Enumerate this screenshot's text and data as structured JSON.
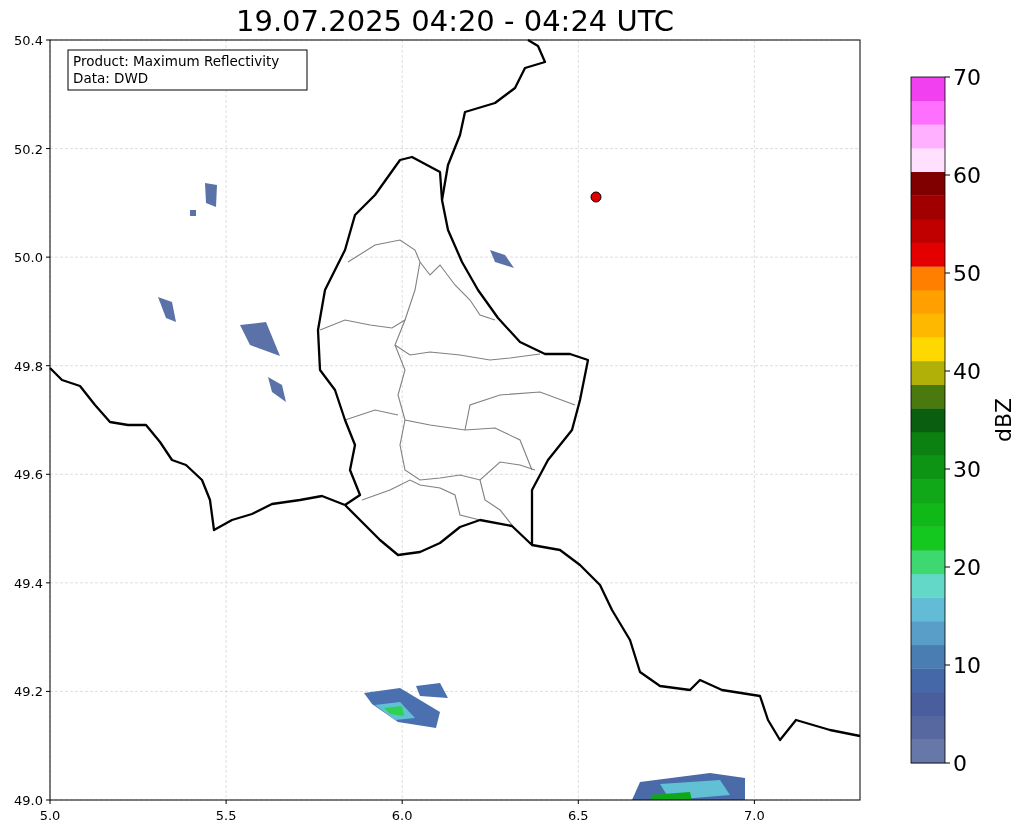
{
  "title": "19.07.2025 04:20 - 04:24 UTC",
  "info_box": {
    "lines": [
      "Product: Maximum Reflectivity",
      "Data: DWD"
    ]
  },
  "x_axis": {
    "ticks": [
      "5.0",
      "5.5",
      "6.0",
      "6.5",
      "7.0"
    ]
  },
  "y_axis": {
    "ticks": [
      "50.4",
      "50.2",
      "50.0",
      "49.8",
      "49.6",
      "49.4",
      "49.2",
      "49.0"
    ]
  },
  "colorbar": {
    "label": "dBZ",
    "ticks": [
      "70",
      "60",
      "50",
      "40",
      "30",
      "20",
      "10",
      "0"
    ],
    "bins": [
      {
        "color": "#6677a8"
      },
      {
        "color": "#5767a0"
      },
      {
        "color": "#4a5e9e"
      },
      {
        "color": "#4468a8"
      },
      {
        "color": "#4a7db2"
      },
      {
        "color": "#589ec8"
      },
      {
        "color": "#62bcd6"
      },
      {
        "color": "#64d8c8"
      },
      {
        "color": "#3ed870"
      },
      {
        "color": "#14c820"
      },
      {
        "color": "#10b818"
      },
      {
        "color": "#10a818"
      },
      {
        "color": "#0e9414"
      },
      {
        "color": "#0c8010"
      },
      {
        "color": "#0a5e10"
      },
      {
        "color": "#4a7a0e"
      },
      {
        "color": "#b0b008"
      },
      {
        "color": "#ffd800"
      },
      {
        "color": "#ffb800"
      },
      {
        "color": "#ffa000"
      },
      {
        "color": "#ff8000"
      },
      {
        "color": "#e40000"
      },
      {
        "color": "#c00000"
      },
      {
        "color": "#a00000"
      },
      {
        "color": "#800000"
      },
      {
        "color": "#ffe0ff"
      },
      {
        "color": "#ffb0ff"
      },
      {
        "color": "#ff70ff"
      },
      {
        "color": "#f040f0"
      }
    ]
  }
}
